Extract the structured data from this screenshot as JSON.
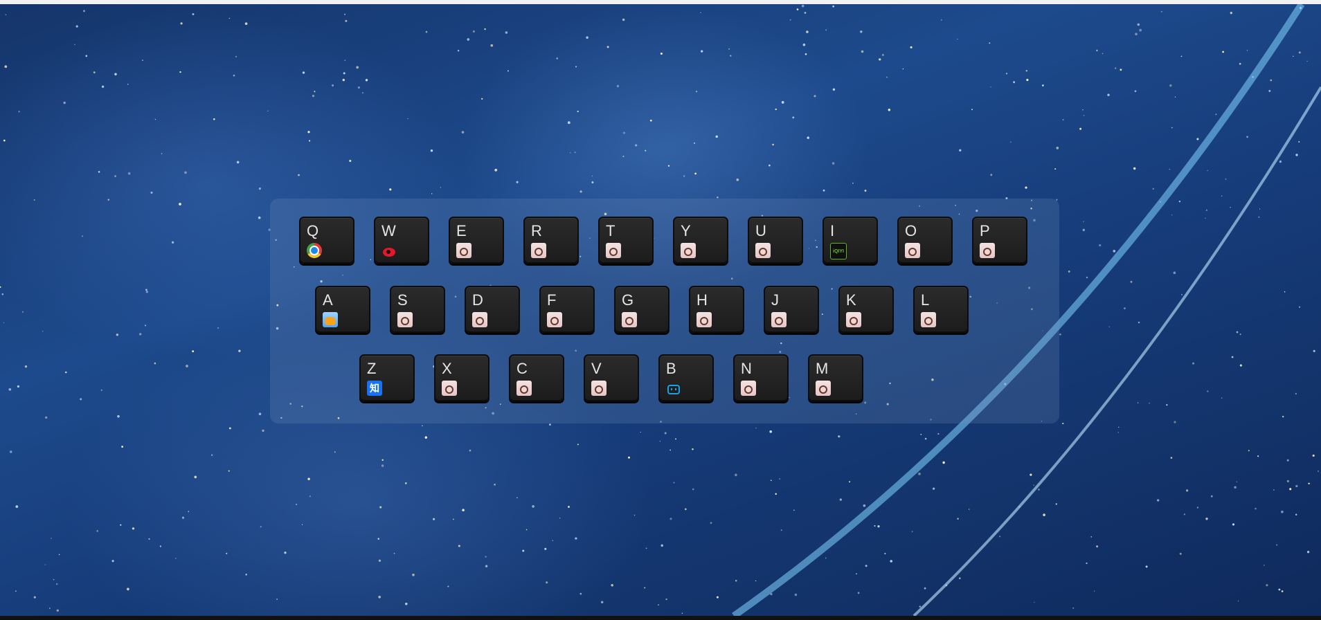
{
  "keyboard": {
    "rows": [
      [
        {
          "letter": "Q",
          "icon": "chrome-icon"
        },
        {
          "letter": "W",
          "icon": "weibo-icon"
        },
        {
          "letter": "E",
          "icon": "default-favicon-icon"
        },
        {
          "letter": "R",
          "icon": "default-favicon-icon"
        },
        {
          "letter": "T",
          "icon": "default-favicon-icon"
        },
        {
          "letter": "Y",
          "icon": "default-favicon-icon"
        },
        {
          "letter": "U",
          "icon": "default-favicon-icon"
        },
        {
          "letter": "I",
          "icon": "iqiyi-icon"
        },
        {
          "letter": "O",
          "icon": "default-favicon-icon"
        },
        {
          "letter": "P",
          "icon": "default-favicon-icon"
        }
      ],
      [
        {
          "letter": "A",
          "icon": "cat-icon"
        },
        {
          "letter": "S",
          "icon": "default-favicon-icon"
        },
        {
          "letter": "D",
          "icon": "default-favicon-icon"
        },
        {
          "letter": "F",
          "icon": "default-favicon-icon"
        },
        {
          "letter": "G",
          "icon": "default-favicon-icon"
        },
        {
          "letter": "H",
          "icon": "default-favicon-icon"
        },
        {
          "letter": "J",
          "icon": "default-favicon-icon"
        },
        {
          "letter": "K",
          "icon": "default-favicon-icon"
        },
        {
          "letter": "L",
          "icon": "default-favicon-icon"
        }
      ],
      [
        {
          "letter": "Z",
          "icon": "zhihu-icon"
        },
        {
          "letter": "X",
          "icon": "default-favicon-icon"
        },
        {
          "letter": "C",
          "icon": "default-favicon-icon"
        },
        {
          "letter": "V",
          "icon": "default-favicon-icon"
        },
        {
          "letter": "B",
          "icon": "bilibili-icon"
        },
        {
          "letter": "N",
          "icon": "default-favicon-icon"
        },
        {
          "letter": "M",
          "icon": "default-favicon-icon"
        }
      ]
    ],
    "icon_text": {
      "iqiyi": "iQIYI",
      "zhihu": "知"
    }
  },
  "colors": {
    "key_face": "#222222",
    "letter": "#e6e6e6",
    "panel": "rgba(120,150,190,0.22)"
  }
}
